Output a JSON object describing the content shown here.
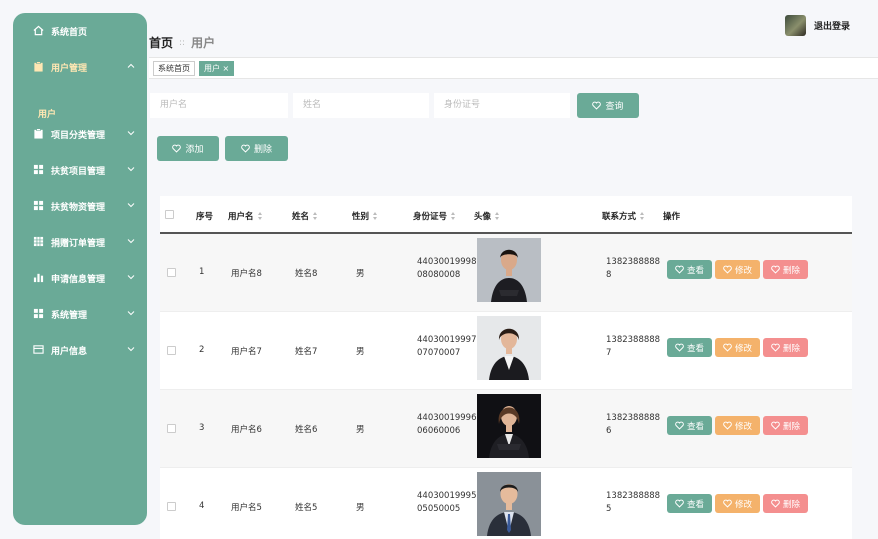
{
  "sidebar": {
    "items": [
      {
        "label": "系统首页",
        "icon": "home-icon"
      },
      {
        "label": "用户管理",
        "icon": "clipboard-icon",
        "active": true
      },
      {
        "label": "项目分类管理",
        "icon": "clipboard-icon"
      },
      {
        "label": "扶贫项目管理",
        "icon": "grid-icon"
      },
      {
        "label": "扶贫物资管理",
        "icon": "grid-icon"
      },
      {
        "label": "捐赠订单管理",
        "icon": "grid-icon"
      },
      {
        "label": "申请信息管理",
        "icon": "bar-chart-icon"
      },
      {
        "label": "系统管理",
        "icon": "grid-icon"
      },
      {
        "label": "用户信息",
        "icon": "card-icon"
      }
    ],
    "sub_item": "用户"
  },
  "header": {
    "logout": "退出登录"
  },
  "breadcrumb": {
    "home": "首页",
    "separator": "::",
    "current": "用户"
  },
  "tags": {
    "home": "系统首页",
    "current": "用户",
    "close": "×"
  },
  "search": {
    "username_placeholder": "用户名",
    "name_placeholder": "姓名",
    "idcard_placeholder": "身份证号",
    "query_label": "查询"
  },
  "actions": {
    "add_label": "添加",
    "delete_label": "删除"
  },
  "table": {
    "headers": {
      "index": "序号",
      "username": "用户名",
      "name": "姓名",
      "gender": "性别",
      "idcard": "身份证号",
      "avatar": "头像",
      "phone": "联系方式",
      "ops": "操作"
    },
    "rows": [
      {
        "index": "1",
        "username": "用户名8",
        "name": "姓名8",
        "gender": "男",
        "idcard_1": "44030019998",
        "idcard_2": "08080008",
        "phone_1": "1382388888",
        "phone_2": "8"
      },
      {
        "index": "2",
        "username": "用户名7",
        "name": "姓名7",
        "gender": "男",
        "idcard_1": "44030019997",
        "idcard_2": "07070007",
        "phone_1": "1382388888",
        "phone_2": "7"
      },
      {
        "index": "3",
        "username": "用户名6",
        "name": "姓名6",
        "gender": "男",
        "idcard_1": "44030019996",
        "idcard_2": "06060006",
        "phone_1": "1382388888",
        "phone_2": "6"
      },
      {
        "index": "4",
        "username": "用户名5",
        "name": "姓名5",
        "gender": "男",
        "idcard_1": "44030019995",
        "idcard_2": "05050005",
        "phone_1": "1382388888",
        "phone_2": "5"
      }
    ],
    "row_actions": {
      "view": "查看",
      "edit": "修改",
      "delete": "删除"
    }
  },
  "colors": {
    "primary": "#6aaa97",
    "edit": "#f4b26b",
    "delete": "#f48f8f",
    "active_text": "#ffe7b3"
  }
}
